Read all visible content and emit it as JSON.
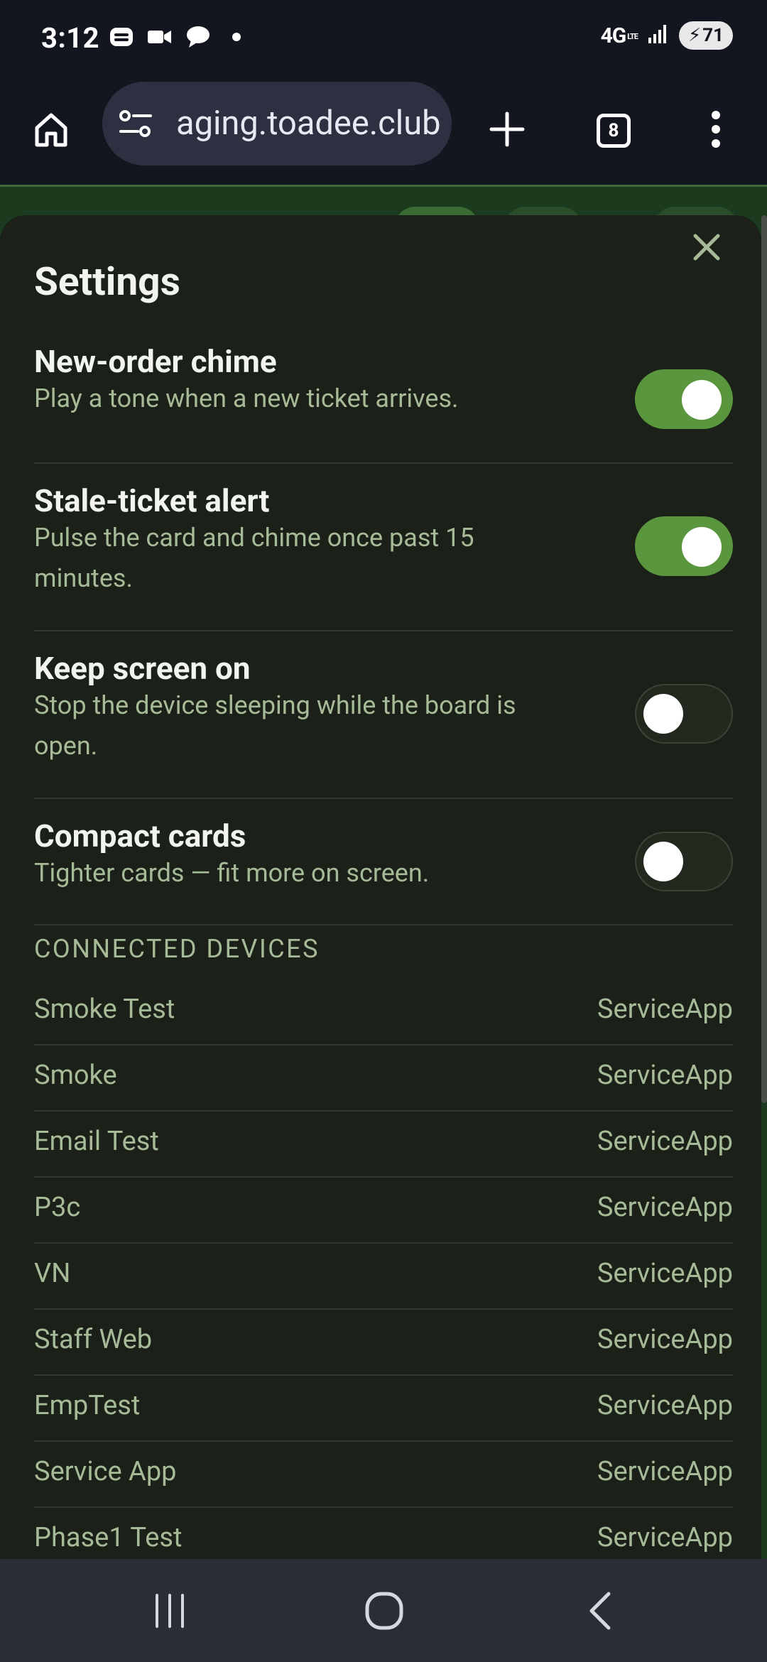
{
  "status_bar": {
    "time": "3:12",
    "network": "4G",
    "network_sub": "LTE",
    "battery": "71",
    "icons": [
      "messenger-icon",
      "video-camera-icon",
      "chat-bubble-icon",
      "dot-icon"
    ]
  },
  "browser": {
    "url_text": "aging.toadee.club",
    "tab_count": "8",
    "icons": [
      "home-icon",
      "site-settings-icon",
      "new-tab-icon",
      "tab-switcher-icon",
      "more-vert-icon"
    ]
  },
  "settings": {
    "title": "Settings",
    "close_icon": "close-icon",
    "items": [
      {
        "title": "New-order chime",
        "description": "Play a tone when a new ticket arrives.",
        "enabled": true
      },
      {
        "title": "Stale-ticket alert",
        "description": "Pulse the card and chime once past 15 minutes.",
        "enabled": true
      },
      {
        "title": "Keep screen on",
        "description": "Stop the device sleeping while the board is open.",
        "enabled": false
      },
      {
        "title": "Compact cards",
        "description": "Tighter cards — fit more on screen.",
        "enabled": false
      }
    ],
    "connected_devices_label": "CONNECTED DEVICES",
    "devices": [
      {
        "name": "Smoke Test",
        "app": "ServiceApp"
      },
      {
        "name": "Smoke",
        "app": "ServiceApp"
      },
      {
        "name": "Email Test",
        "app": "ServiceApp"
      },
      {
        "name": "P3c",
        "app": "ServiceApp"
      },
      {
        "name": "VN",
        "app": "ServiceApp"
      },
      {
        "name": "Staff Web",
        "app": "ServiceApp"
      },
      {
        "name": "EmpTest",
        "app": "ServiceApp"
      },
      {
        "name": "Service App",
        "app": "ServiceApp"
      },
      {
        "name": "Phase1 Test",
        "app": "ServiceApp"
      }
    ]
  },
  "nav_bar": {
    "icons": [
      "recents-icon",
      "home-circle-icon",
      "back-icon"
    ]
  },
  "colors": {
    "toggle_on": "#5a963e",
    "sheet_bg": "#1b2119",
    "muted_text": "#a7ba98"
  }
}
